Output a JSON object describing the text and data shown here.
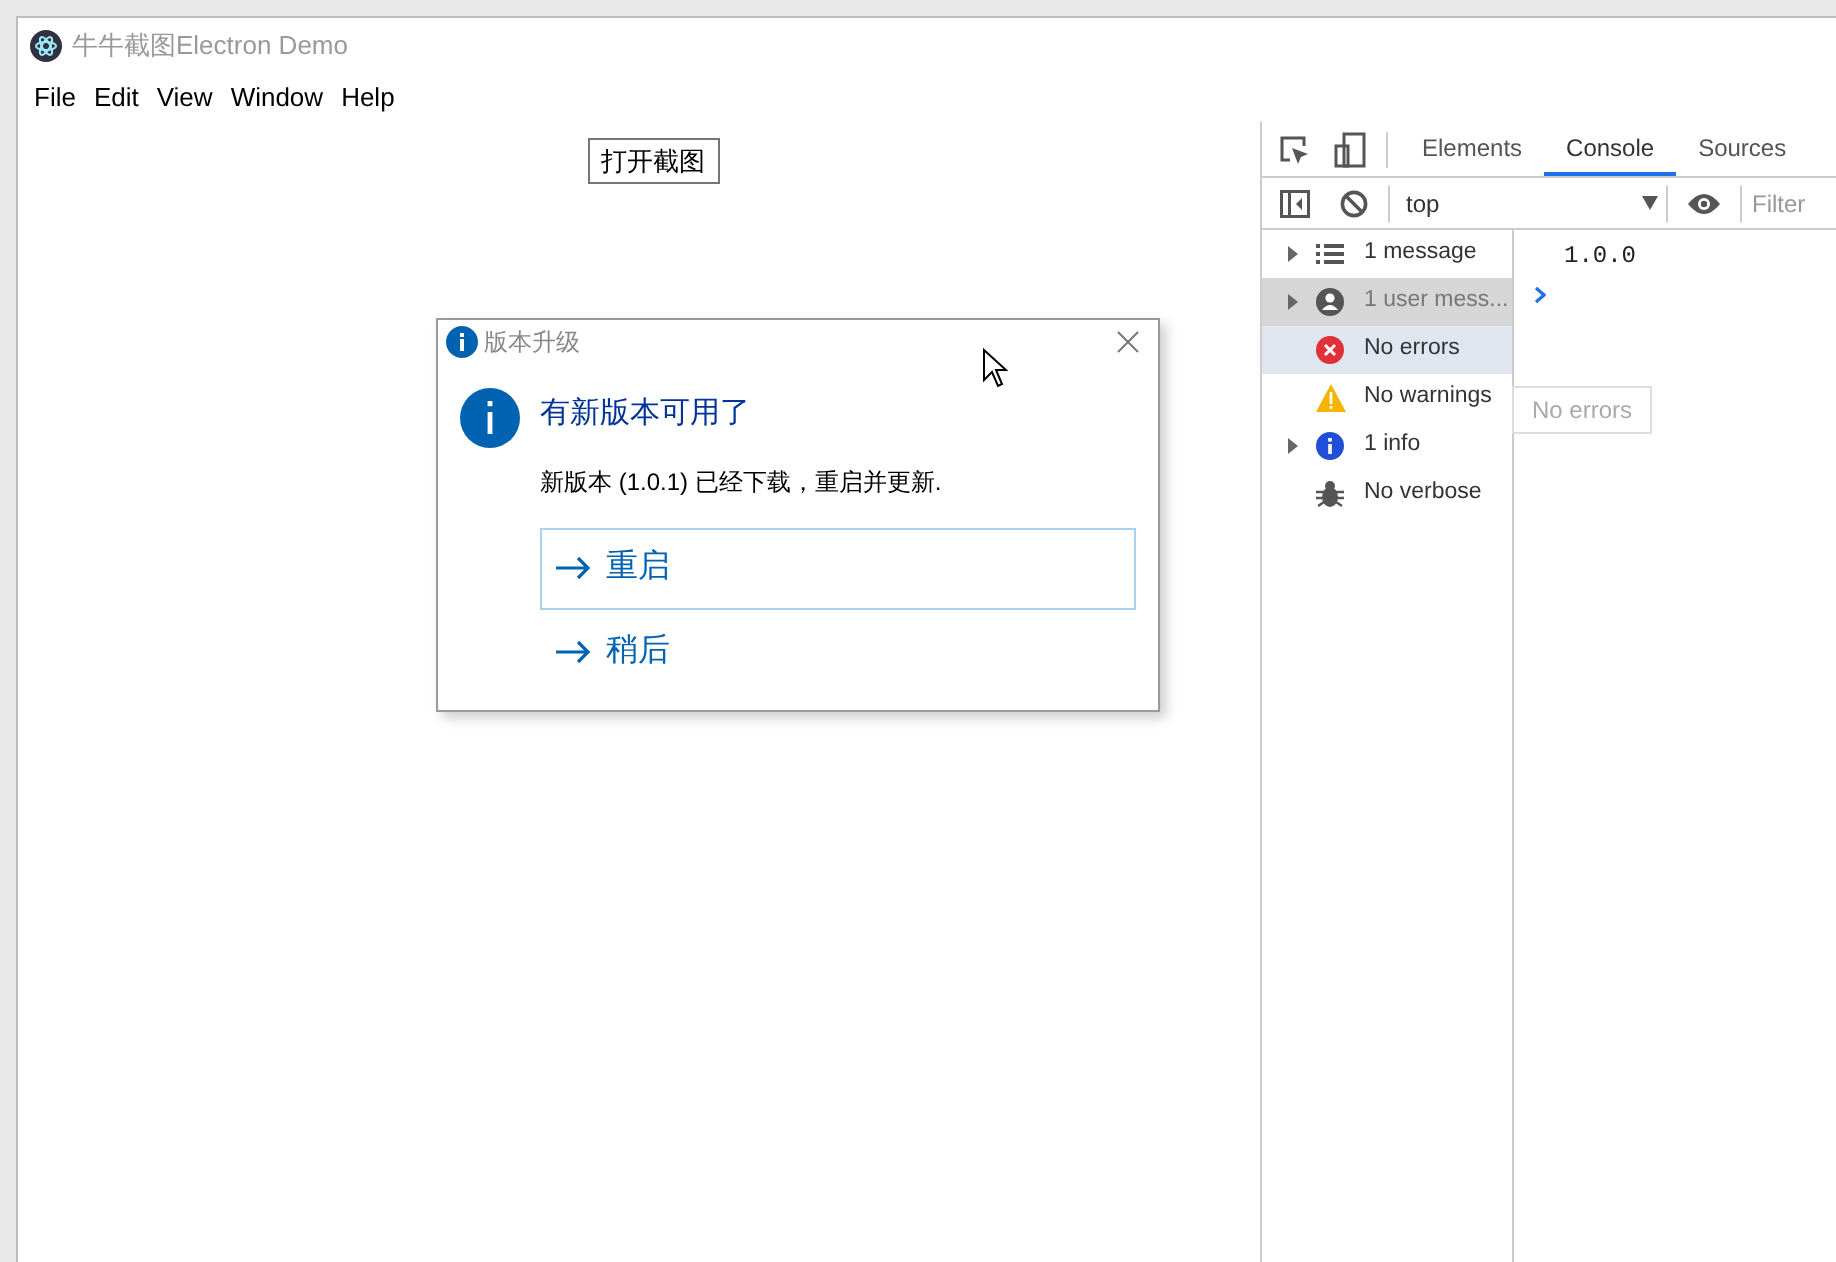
{
  "window": {
    "title": "牛牛截图Electron Demo"
  },
  "menu": [
    "File",
    "Edit",
    "View",
    "Window",
    "Help"
  ],
  "open_button": "打开截图",
  "dialog": {
    "title": "版本升级",
    "heading": "有新版本可用了",
    "message": "新版本 (1.0.1) 已经下载，重启并更新.",
    "options": [
      {
        "label": "重启",
        "selected": true
      },
      {
        "label": "稍后",
        "selected": false
      }
    ]
  },
  "devtools": {
    "tabs": [
      {
        "label": "Elements",
        "selected": false
      },
      {
        "label": "Console",
        "selected": true
      },
      {
        "label": "Sources",
        "selected": false
      }
    ],
    "context": "top",
    "filter_placeholder": "Filter",
    "sidebar": [
      {
        "kind": "message",
        "label": "1 message",
        "expandable": true,
        "selected": false,
        "hovered": false
      },
      {
        "kind": "user",
        "label": "1 user mess...",
        "expandable": true,
        "selected": false,
        "hovered": true
      },
      {
        "kind": "error",
        "label": "No errors",
        "expandable": false,
        "selected": true,
        "hovered": false
      },
      {
        "kind": "warning",
        "label": "No warnings",
        "expandable": false,
        "selected": false,
        "hovered": false
      },
      {
        "kind": "info",
        "label": "1 info",
        "expandable": true,
        "selected": false,
        "hovered": false
      },
      {
        "kind": "verbose",
        "label": "No verbose",
        "expandable": false,
        "selected": false,
        "hovered": false
      }
    ],
    "tooltip": "No errors",
    "console_lines": [
      "1.0.0"
    ]
  }
}
